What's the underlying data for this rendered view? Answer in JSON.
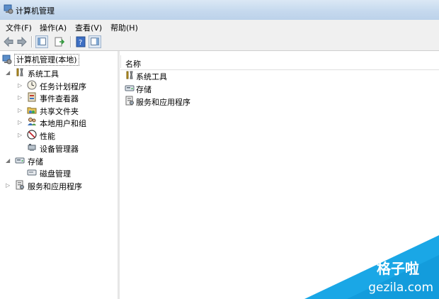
{
  "window": {
    "title": "计算机管理"
  },
  "menu": [
    "文件(F)",
    "操作(A)",
    "查看(V)",
    "帮助(H)"
  ],
  "tree": {
    "root": "计算机管理(本地)",
    "system_tools": "系统工具",
    "task_scheduler": "任务计划程序",
    "event_viewer": "事件查看器",
    "shared_folders": "共享文件夹",
    "local_users": "本地用户和组",
    "performance": "性能",
    "device_manager": "设备管理器",
    "storage": "存储",
    "disk_management": "磁盘管理",
    "services_apps": "服务和应用程序"
  },
  "list": {
    "column_name": "名称",
    "items": [
      "系统工具",
      "存储",
      "服务和应用程序"
    ]
  },
  "watermark": {
    "line1": "格子啦",
    "line2": "gezila.com"
  },
  "colors": {
    "accent": "#1aa7e6",
    "title_gradient_top": "#dbe8f5"
  }
}
